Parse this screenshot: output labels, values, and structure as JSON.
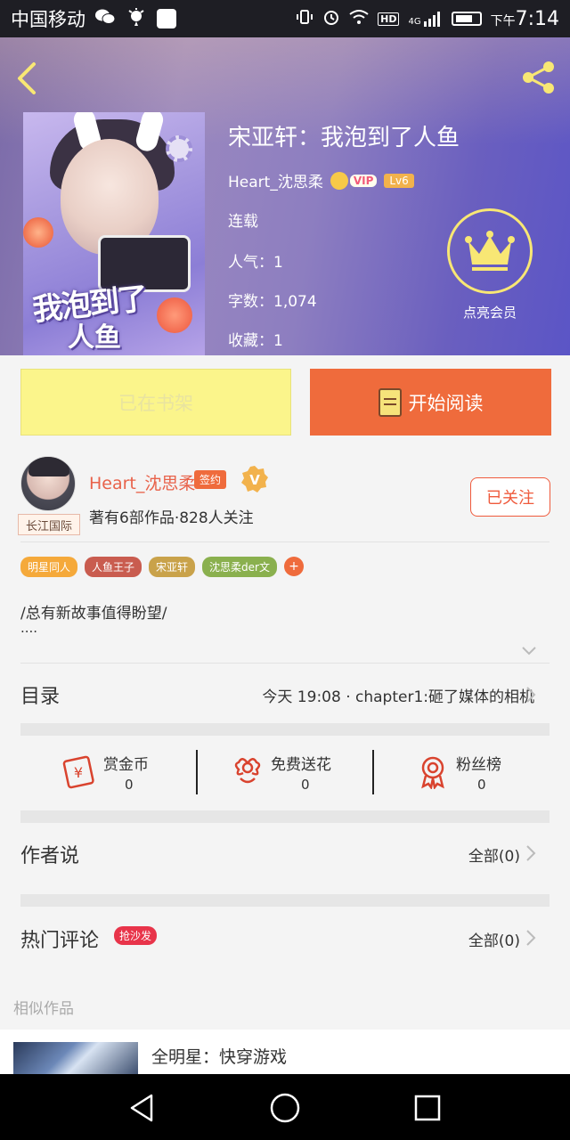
{
  "status_bar": {
    "carrier": "中国移动",
    "time_prefix": "下午",
    "time": "7:14",
    "hd": "HD",
    "net": "4G"
  },
  "book": {
    "title": "宋亚轩：我泡到了人鱼",
    "author": "Heart_沈思柔",
    "vip_label": "VIP",
    "level": "Lv6",
    "status": "连载",
    "popularity": "人气：1",
    "word_count": "字数：1,074",
    "favorites": "收藏：1",
    "cover_title_line1": "我泡到了",
    "cover_title_line2": "人鱼"
  },
  "vip_promo": {
    "label": "点亮会员"
  },
  "actions": {
    "shelf_label": "已在书架",
    "read_label": "开始阅读"
  },
  "author_card": {
    "name": "Heart_沈思柔",
    "signed_badge": "签约",
    "verified_badge": "V",
    "stats": "著有6部作品·828人关注",
    "follow_label": "已关注",
    "avatar_tag": "长江国际"
  },
  "tags": [
    {
      "label": "明星同人",
      "color": "#f5a93a"
    },
    {
      "label": "人鱼王子",
      "color": "#c95c4f"
    },
    {
      "label": "宋亚轩",
      "color": "#c9a24a"
    },
    {
      "label": "沈思柔der文",
      "color": "#8ab04e"
    }
  ],
  "tag_add": "+",
  "description": {
    "line1": "/总有新故事值得盼望/",
    "line2": "...."
  },
  "toc": {
    "label": "目录",
    "latest": "今天 19:08 · chapter1:砸了媒体的相机"
  },
  "stats": [
    {
      "title": "赏金币",
      "value": "0",
      "icon": "reward-coin-icon"
    },
    {
      "title": "免费送花",
      "value": "0",
      "icon": "flower-icon"
    },
    {
      "title": "粉丝榜",
      "value": "0",
      "icon": "medal-icon"
    }
  ],
  "author_says": {
    "label": "作者说",
    "right": "全部(0)"
  },
  "hot_comments": {
    "label": "热门评论",
    "badge": "抢沙发",
    "right": "全部(0)"
  },
  "similar": {
    "label": "相似作品",
    "first_title": "全明星：快穿游戏"
  },
  "colors": {
    "accent": "#ef6b3c",
    "shelf_button": "#fbf58b",
    "header_gradient_start": "#7a6aa8",
    "header_gradient_end": "#5b55c6"
  }
}
